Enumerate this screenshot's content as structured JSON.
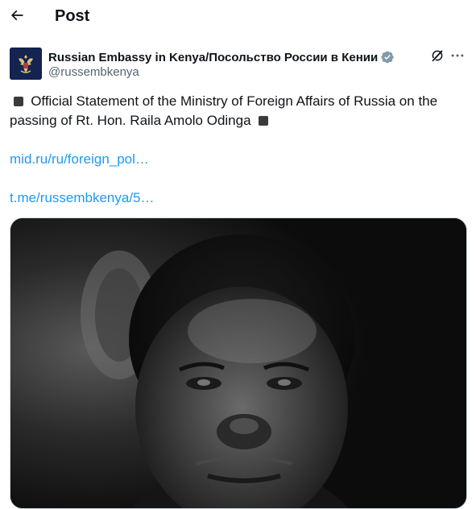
{
  "header": {
    "title": "Post"
  },
  "author": {
    "display_name": "Russian Embassy in Kenya/Посольство России в Кении",
    "handle": "@russembkenya"
  },
  "post": {
    "text": "Official Statement of the Ministry of Foreign Affairs of Russia on the passing of Rt. Hon. Raila Amolo Odinga",
    "links": [
      "mid.ru/ru/foreign_pol…",
      "t.me/russembkenya/5…"
    ]
  },
  "icons": {
    "back": "arrow-left-icon",
    "verified": "verified-badge-icon",
    "grok": "grok-icon",
    "more": "more-horizontal-icon"
  },
  "colors": {
    "link": "#1d9bf0",
    "verified": "#829aab",
    "handle": "#536471",
    "avatar_bg": "#14234f"
  }
}
